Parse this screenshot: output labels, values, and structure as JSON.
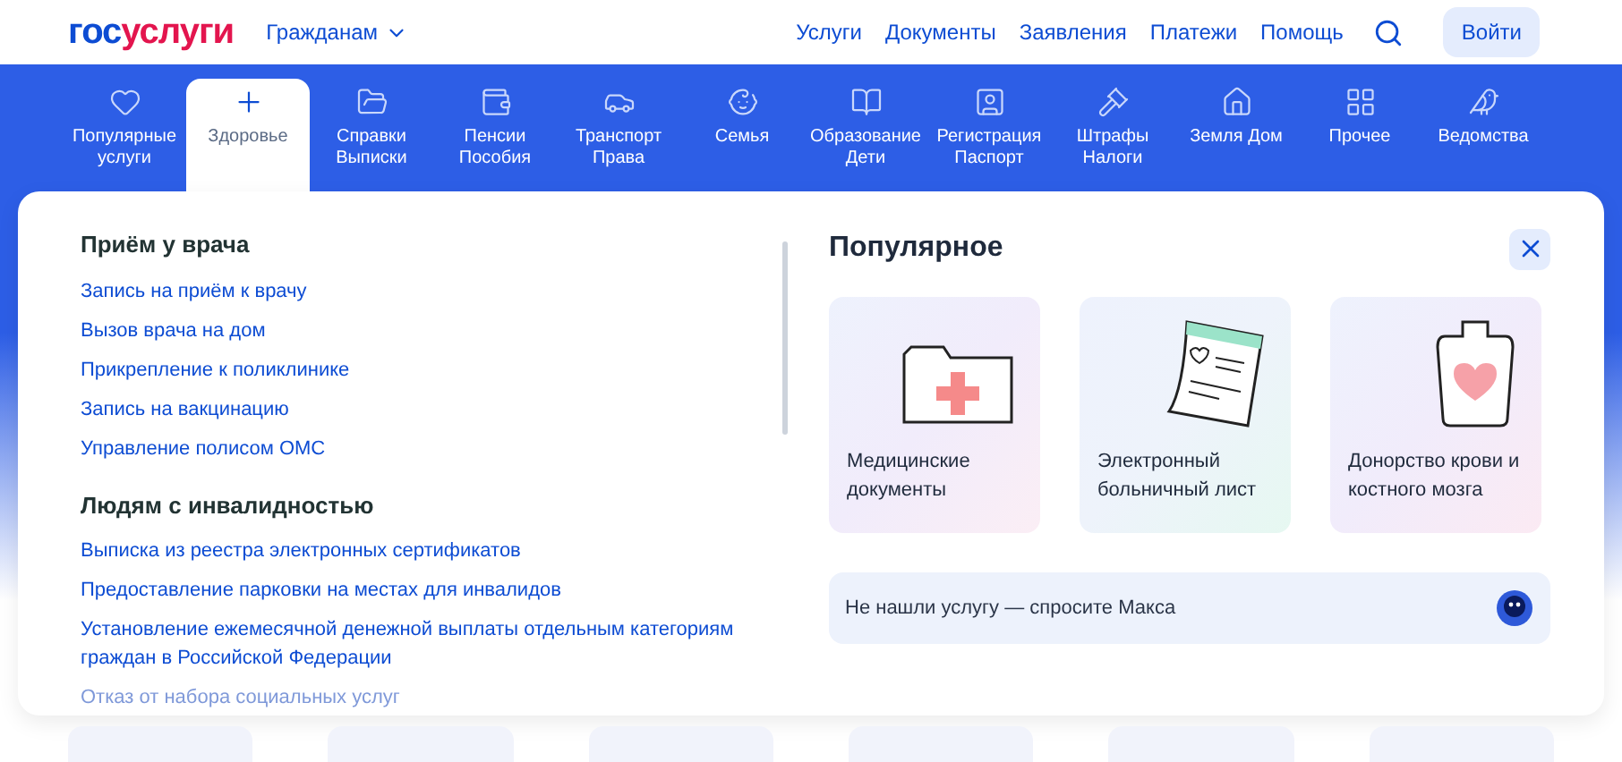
{
  "header": {
    "logo": {
      "part1": "гос",
      "part2": "услуги"
    },
    "audience": "Гражданам",
    "links": [
      "Услуги",
      "Документы",
      "Заявления",
      "Платежи",
      "Помощь"
    ],
    "login": "Войти"
  },
  "categories": [
    {
      "label": "Популярные услуги",
      "selected": false
    },
    {
      "label": "Здоровье",
      "selected": true
    },
    {
      "label": "Справки Выписки",
      "selected": false
    },
    {
      "label": "Пенсии Пособия",
      "selected": false
    },
    {
      "label": "Транспорт Права",
      "selected": false
    },
    {
      "label": "Семья",
      "selected": false
    },
    {
      "label": "Образование Дети",
      "selected": false
    },
    {
      "label": "Регистрация Паспорт",
      "selected": false
    },
    {
      "label": "Штрафы Налоги",
      "selected": false
    },
    {
      "label": "Земля Дом",
      "selected": false
    },
    {
      "label": "Прочее",
      "selected": false
    },
    {
      "label": "Ведомства",
      "selected": false
    }
  ],
  "sections": [
    {
      "title": "Приём у врача",
      "links": [
        {
          "text": "Запись на приём к врачу",
          "faded": false
        },
        {
          "text": "Вызов врача на дом",
          "faded": false
        },
        {
          "text": "Прикрепление к поликлинике",
          "faded": false
        },
        {
          "text": "Запись на вакцинацию",
          "faded": false
        },
        {
          "text": "Управление полисом ОМС",
          "faded": false
        }
      ]
    },
    {
      "title": "Людям с инвалидностью",
      "links": [
        {
          "text": "Выписка из реестра электронных сертификатов",
          "faded": false
        },
        {
          "text": "Предоставление парковки на местах для инвалидов",
          "faded": false
        },
        {
          "text": "Установление ежемесячной денежной выплаты отдельным категориям граждан в Российской Федерации",
          "faded": false
        },
        {
          "text": "Отказ от набора социальных услуг",
          "faded": true
        }
      ]
    }
  ],
  "popular": {
    "title": "Популярное",
    "cards": [
      {
        "kind": "folder",
        "label": "Медицинские документы"
      },
      {
        "kind": "sheet",
        "label": "Электронный больничный лист"
      },
      {
        "kind": "bag",
        "label": "Донорство крови и костного мозга"
      }
    ],
    "ask": "Не нашли услугу — спросите Макса"
  }
}
